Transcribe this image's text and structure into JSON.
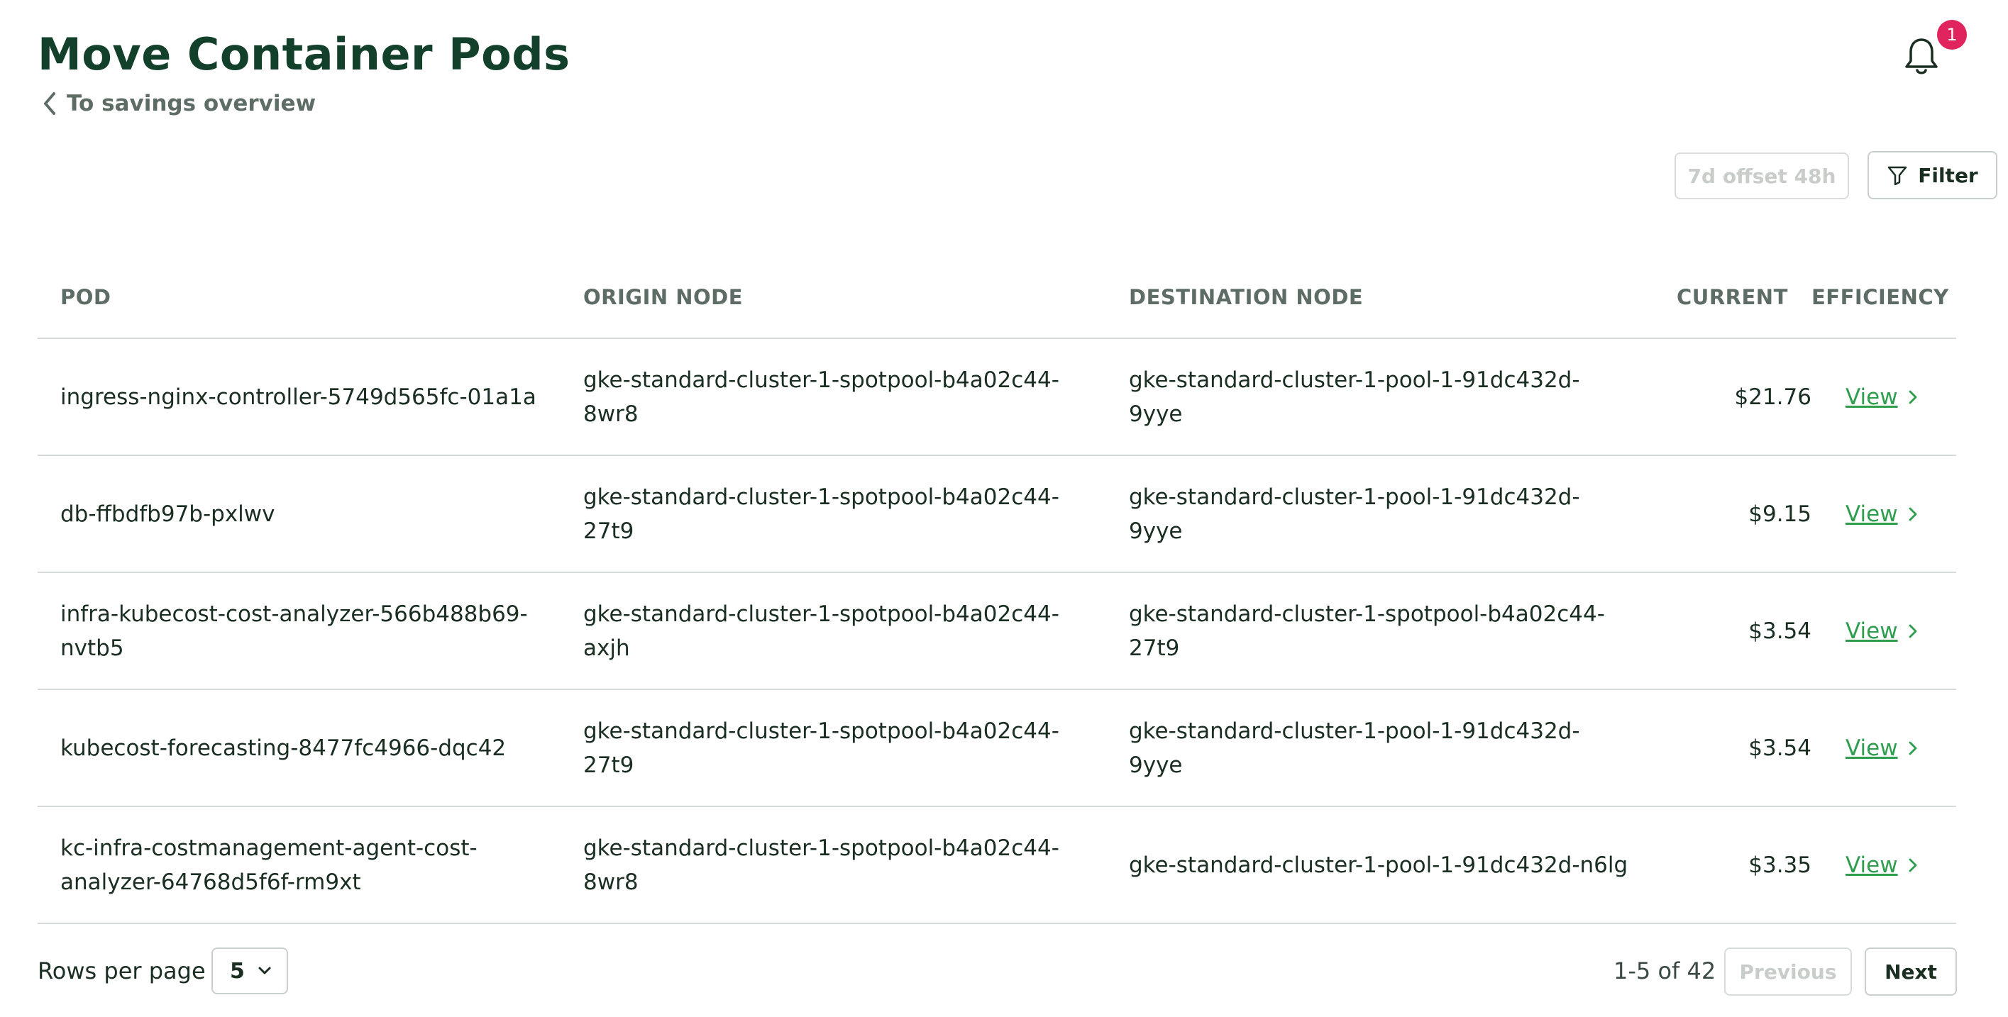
{
  "header": {
    "title": "Move Container Pods",
    "back_link": "To savings overview",
    "notification_count": "1"
  },
  "toolbar": {
    "window_label": "7d offset 48h",
    "filter_label": "Filter"
  },
  "table": {
    "columns": [
      "POD",
      "ORIGIN NODE",
      "DESTINATION NODE",
      "CURRENT",
      "EFFICIENCY"
    ],
    "rows": [
      {
        "pod": [
          "ingress-nginx-controller-5749d565fc-01a1a"
        ],
        "origin": [
          "gke-standard-cluster-1-spotpool-b4a02c44-",
          "8wr8"
        ],
        "destination": [
          "gke-standard-cluster-1-pool-1-91dc432d-",
          "9yye"
        ],
        "current": "$21.76",
        "efficiency": "View"
      },
      {
        "pod": [
          "db-ffbdfb97b-pxlwv"
        ],
        "origin": [
          "gke-standard-cluster-1-spotpool-b4a02c44-",
          "27t9"
        ],
        "destination": [
          "gke-standard-cluster-1-pool-1-91dc432d-",
          "9yye"
        ],
        "current": "$9.15",
        "efficiency": "View"
      },
      {
        "pod": [
          "infra-kubecost-cost-analyzer-566b488b69-",
          "nvtb5"
        ],
        "origin": [
          "gke-standard-cluster-1-spotpool-b4a02c44-",
          "axjh"
        ],
        "destination": [
          "gke-standard-cluster-1-spotpool-b4a02c44-",
          "27t9"
        ],
        "current": "$3.54",
        "efficiency": "View"
      },
      {
        "pod": [
          "kubecost-forecasting-8477fc4966-dqc42"
        ],
        "origin": [
          "gke-standard-cluster-1-spotpool-b4a02c44-",
          "27t9"
        ],
        "destination": [
          "gke-standard-cluster-1-pool-1-91dc432d-",
          "9yye"
        ],
        "current": "$3.54",
        "efficiency": "View"
      },
      {
        "pod": [
          "kc-infra-costmanagement-agent-cost-",
          "analyzer-64768d5f6f-rm9xt"
        ],
        "origin": [
          "gke-standard-cluster-1-spotpool-b4a02c44-",
          "8wr8"
        ],
        "destination": [
          "gke-standard-cluster-1-pool-1-91dc432d-n6lg"
        ],
        "current": "$3.35",
        "efficiency": "View"
      }
    ]
  },
  "footer": {
    "rows_per_page_label": "Rows per page",
    "rows_per_page_value": "5",
    "range_text": "1-5 of 42",
    "previous_label": "Previous",
    "next_label": "Next"
  },
  "colors": {
    "title": "#13402b",
    "link_green": "#2e9e4e",
    "badge": "#e0245e",
    "muted": "#5d6d65",
    "border": "#d6dad8"
  },
  "icons": {
    "back": "chevron-left-icon",
    "notifications": "bell-icon",
    "filter": "filter-icon",
    "row_action": "chevron-right-icon",
    "select": "chevron-down-icon"
  }
}
